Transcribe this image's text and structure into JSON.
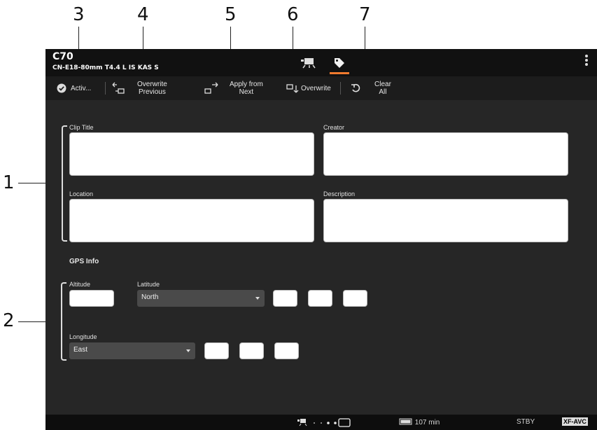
{
  "callouts": {
    "c1": "1",
    "c2": "2",
    "c3": "3",
    "c4": "4",
    "c5": "5",
    "c6": "6",
    "c7": "7"
  },
  "header": {
    "model": "C70",
    "lens": "CN-E18-80mm T4.4 L IS KAS S"
  },
  "tabs": [
    {
      "name": "camera",
      "icon": "camera-icon",
      "active": false
    },
    {
      "name": "metadata",
      "icon": "tag-icon",
      "active": true
    }
  ],
  "toolbar": {
    "activate_label": "Activ...",
    "overwrite_previous_label_1": "Overwrite",
    "overwrite_previous_label_2": "Previous",
    "apply_next_label_1": "Apply from",
    "apply_next_label_2": "Next",
    "overwrite_label": "Overwrite",
    "clear_all_label_1": "Clear",
    "clear_all_label_2": "All"
  },
  "fields": {
    "clip_title_label": "Clip Title",
    "creator_label": "Creator",
    "location_label": "Location",
    "description_label": "Description"
  },
  "gps": {
    "title": "GPS Info",
    "altitude_label": "Altitude",
    "latitude_label": "Latitude",
    "latitude_value": "North",
    "longitude_label": "Longitude",
    "longitude_value": "East"
  },
  "status": {
    "battery": "107 min",
    "mode": "STBY",
    "format": "XF-AVC"
  },
  "colors": {
    "accent": "#f07a2e",
    "screen_bg": "#262626"
  }
}
